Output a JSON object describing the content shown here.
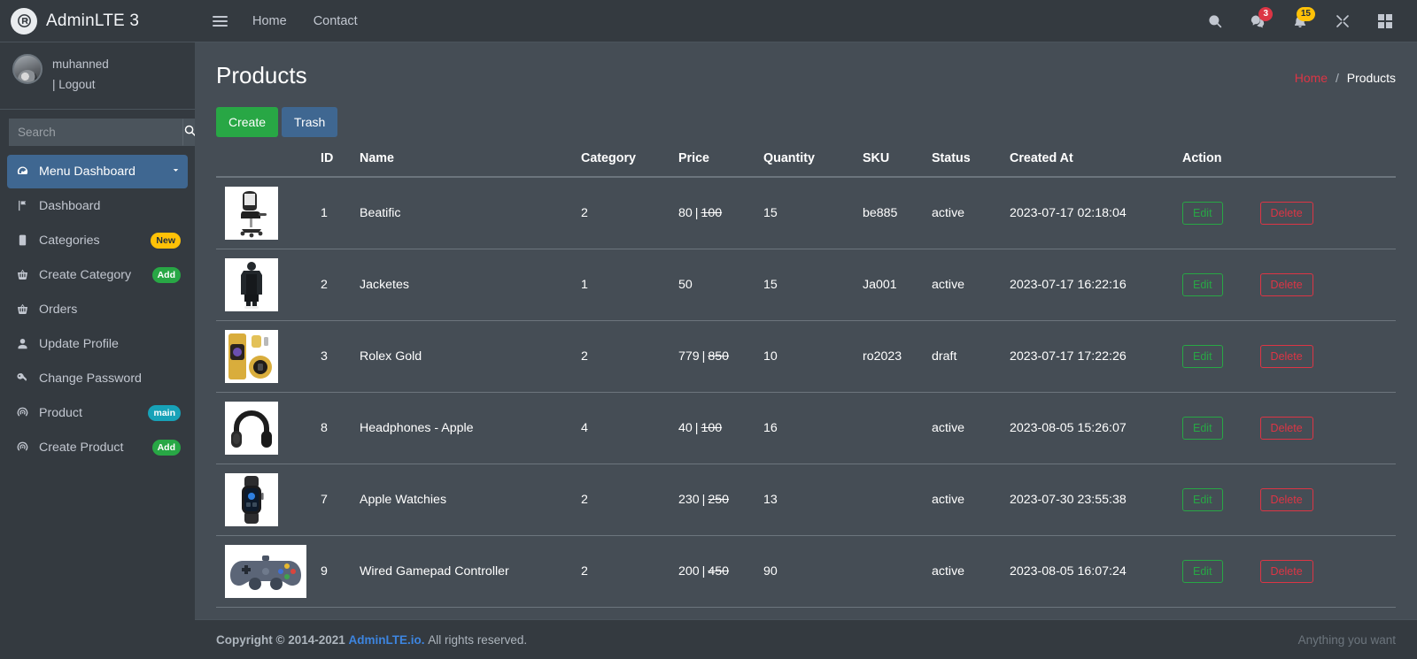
{
  "brand": {
    "title": "AdminLTE 3",
    "logo_icon": "adminlte-logo-icon"
  },
  "user_panel": {
    "name": "muhanned",
    "logout_label": "| Logout"
  },
  "sidebar": {
    "search": {
      "placeholder": "Search",
      "button_icon": "search-icon"
    },
    "items": [
      {
        "label": "Menu Dashboard",
        "icon": "tachometer-icon",
        "active": true,
        "chevron": "❯"
      },
      {
        "label": "Dashboard",
        "icon": "flag-icon"
      },
      {
        "label": "Categories",
        "icon": "tablet-icon",
        "badge": "New",
        "badge_type": "new"
      },
      {
        "label": "Create Category",
        "icon": "basket-icon",
        "badge": "Add",
        "badge_type": "add"
      },
      {
        "label": "Orders",
        "icon": "basket-icon"
      },
      {
        "label": "Update Profile",
        "icon": "user-icon"
      },
      {
        "label": "Change Password",
        "icon": "key-icon"
      },
      {
        "label": "Product",
        "icon": "broadcast-icon",
        "badge": "main",
        "badge_type": "main"
      },
      {
        "label": "Create Product",
        "icon": "broadcast-icon",
        "badge": "Add",
        "badge_type": "add"
      }
    ]
  },
  "navbar": {
    "toggle_icon": "hamburger-icon",
    "links": [
      {
        "label": "Home"
      },
      {
        "label": "Contact"
      }
    ],
    "icons": [
      {
        "name": "search-icon",
        "badge": null
      },
      {
        "name": "messages-icon",
        "badge": "3",
        "badge_type": "danger"
      },
      {
        "name": "notifications-icon",
        "badge": "15",
        "badge_type": "warning"
      },
      {
        "name": "fullscreen-icon",
        "badge": null
      },
      {
        "name": "grid-icon",
        "badge": null
      }
    ]
  },
  "page": {
    "title": "Products",
    "breadcrumb": {
      "home": "Home",
      "separator": "/",
      "current": "Products"
    },
    "buttons": {
      "create": "Create",
      "trash": "Trash"
    }
  },
  "table": {
    "columns": [
      "",
      "ID",
      "Name",
      "Category",
      "Price",
      "Quantity",
      "SKU",
      "Status",
      "Created At",
      "Action"
    ],
    "actions": {
      "edit": "Edit",
      "delete": "Delete"
    },
    "rows": [
      {
        "image": "office-chair",
        "id": "1",
        "name": "Beatific",
        "category": "2",
        "price": "80",
        "old_price": "100",
        "quantity": "15",
        "sku": "be885",
        "status": "active",
        "created_at": "2023-07-17 02:18:04"
      },
      {
        "image": "black-coat",
        "id": "2",
        "name": "Jacketes",
        "category": "1",
        "price": "50",
        "old_price": "",
        "quantity": "15",
        "sku": "Ja001",
        "status": "active",
        "created_at": "2023-07-17 16:22:16"
      },
      {
        "image": "gold-watch",
        "id": "3",
        "name": "Rolex Gold",
        "category": "2",
        "price": "779",
        "old_price": "850",
        "quantity": "10",
        "sku": "ro2023",
        "status": "draft",
        "created_at": "2023-07-17 17:22:26"
      },
      {
        "image": "headphones",
        "id": "8",
        "name": "Headphones - Apple",
        "category": "4",
        "price": "40",
        "old_price": "100",
        "quantity": "16",
        "sku": "",
        "status": "active",
        "created_at": "2023-08-05 15:26:07"
      },
      {
        "image": "smartwatch",
        "id": "7",
        "name": "Apple Watchies",
        "category": "2",
        "price": "230",
        "old_price": "250",
        "quantity": "13",
        "sku": "",
        "status": "active",
        "created_at": "2023-07-30 23:55:38"
      },
      {
        "image": "gamepad",
        "id": "9",
        "name": "Wired Gamepad Controller",
        "category": "2",
        "price": "200",
        "old_price": "450",
        "quantity": "90",
        "sku": "",
        "status": "active",
        "created_at": "2023-08-05 16:07:24"
      }
    ]
  },
  "footer": {
    "copyright_prefix": "Copyright © 2014-2021",
    "link": "AdminLTE.io.",
    "rights": "All rights reserved.",
    "right_text": "Anything you want"
  },
  "colors": {
    "sidebar_bg": "#343a40",
    "content_bg": "#454d55",
    "accent_blue": "#3f6791",
    "success": "#28a745",
    "danger": "#dc3545",
    "warning": "#ffc107",
    "info": "#17a2b8",
    "link_blue": "#3d85e0"
  }
}
